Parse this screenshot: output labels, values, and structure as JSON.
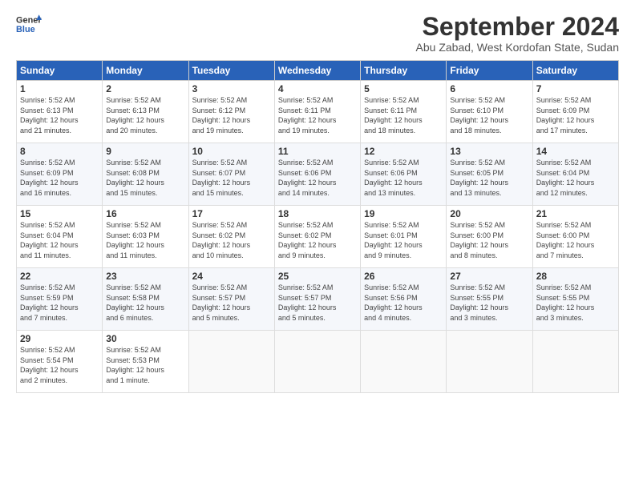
{
  "logo": {
    "line1": "General",
    "line2": "Blue"
  },
  "title": "September 2024",
  "subtitle": "Abu Zabad, West Kordofan State, Sudan",
  "headers": [
    "Sunday",
    "Monday",
    "Tuesday",
    "Wednesday",
    "Thursday",
    "Friday",
    "Saturday"
  ],
  "weeks": [
    [
      {
        "day": "1",
        "info": "Sunrise: 5:52 AM\nSunset: 6:13 PM\nDaylight: 12 hours\nand 21 minutes."
      },
      {
        "day": "2",
        "info": "Sunrise: 5:52 AM\nSunset: 6:13 PM\nDaylight: 12 hours\nand 20 minutes."
      },
      {
        "day": "3",
        "info": "Sunrise: 5:52 AM\nSunset: 6:12 PM\nDaylight: 12 hours\nand 19 minutes."
      },
      {
        "day": "4",
        "info": "Sunrise: 5:52 AM\nSunset: 6:11 PM\nDaylight: 12 hours\nand 19 minutes."
      },
      {
        "day": "5",
        "info": "Sunrise: 5:52 AM\nSunset: 6:11 PM\nDaylight: 12 hours\nand 18 minutes."
      },
      {
        "day": "6",
        "info": "Sunrise: 5:52 AM\nSunset: 6:10 PM\nDaylight: 12 hours\nand 18 minutes."
      },
      {
        "day": "7",
        "info": "Sunrise: 5:52 AM\nSunset: 6:09 PM\nDaylight: 12 hours\nand 17 minutes."
      }
    ],
    [
      {
        "day": "8",
        "info": "Sunrise: 5:52 AM\nSunset: 6:09 PM\nDaylight: 12 hours\nand 16 minutes."
      },
      {
        "day": "9",
        "info": "Sunrise: 5:52 AM\nSunset: 6:08 PM\nDaylight: 12 hours\nand 15 minutes."
      },
      {
        "day": "10",
        "info": "Sunrise: 5:52 AM\nSunset: 6:07 PM\nDaylight: 12 hours\nand 15 minutes."
      },
      {
        "day": "11",
        "info": "Sunrise: 5:52 AM\nSunset: 6:06 PM\nDaylight: 12 hours\nand 14 minutes."
      },
      {
        "day": "12",
        "info": "Sunrise: 5:52 AM\nSunset: 6:06 PM\nDaylight: 12 hours\nand 13 minutes."
      },
      {
        "day": "13",
        "info": "Sunrise: 5:52 AM\nSunset: 6:05 PM\nDaylight: 12 hours\nand 13 minutes."
      },
      {
        "day": "14",
        "info": "Sunrise: 5:52 AM\nSunset: 6:04 PM\nDaylight: 12 hours\nand 12 minutes."
      }
    ],
    [
      {
        "day": "15",
        "info": "Sunrise: 5:52 AM\nSunset: 6:04 PM\nDaylight: 12 hours\nand 11 minutes."
      },
      {
        "day": "16",
        "info": "Sunrise: 5:52 AM\nSunset: 6:03 PM\nDaylight: 12 hours\nand 11 minutes."
      },
      {
        "day": "17",
        "info": "Sunrise: 5:52 AM\nSunset: 6:02 PM\nDaylight: 12 hours\nand 10 minutes."
      },
      {
        "day": "18",
        "info": "Sunrise: 5:52 AM\nSunset: 6:02 PM\nDaylight: 12 hours\nand 9 minutes."
      },
      {
        "day": "19",
        "info": "Sunrise: 5:52 AM\nSunset: 6:01 PM\nDaylight: 12 hours\nand 9 minutes."
      },
      {
        "day": "20",
        "info": "Sunrise: 5:52 AM\nSunset: 6:00 PM\nDaylight: 12 hours\nand 8 minutes."
      },
      {
        "day": "21",
        "info": "Sunrise: 5:52 AM\nSunset: 6:00 PM\nDaylight: 12 hours\nand 7 minutes."
      }
    ],
    [
      {
        "day": "22",
        "info": "Sunrise: 5:52 AM\nSunset: 5:59 PM\nDaylight: 12 hours\nand 7 minutes."
      },
      {
        "day": "23",
        "info": "Sunrise: 5:52 AM\nSunset: 5:58 PM\nDaylight: 12 hours\nand 6 minutes."
      },
      {
        "day": "24",
        "info": "Sunrise: 5:52 AM\nSunset: 5:57 PM\nDaylight: 12 hours\nand 5 minutes."
      },
      {
        "day": "25",
        "info": "Sunrise: 5:52 AM\nSunset: 5:57 PM\nDaylight: 12 hours\nand 5 minutes."
      },
      {
        "day": "26",
        "info": "Sunrise: 5:52 AM\nSunset: 5:56 PM\nDaylight: 12 hours\nand 4 minutes."
      },
      {
        "day": "27",
        "info": "Sunrise: 5:52 AM\nSunset: 5:55 PM\nDaylight: 12 hours\nand 3 minutes."
      },
      {
        "day": "28",
        "info": "Sunrise: 5:52 AM\nSunset: 5:55 PM\nDaylight: 12 hours\nand 3 minutes."
      }
    ],
    [
      {
        "day": "29",
        "info": "Sunrise: 5:52 AM\nSunset: 5:54 PM\nDaylight: 12 hours\nand 2 minutes."
      },
      {
        "day": "30",
        "info": "Sunrise: 5:52 AM\nSunset: 5:53 PM\nDaylight: 12 hours\nand 1 minute."
      },
      {
        "day": "",
        "info": ""
      },
      {
        "day": "",
        "info": ""
      },
      {
        "day": "",
        "info": ""
      },
      {
        "day": "",
        "info": ""
      },
      {
        "day": "",
        "info": ""
      }
    ]
  ]
}
